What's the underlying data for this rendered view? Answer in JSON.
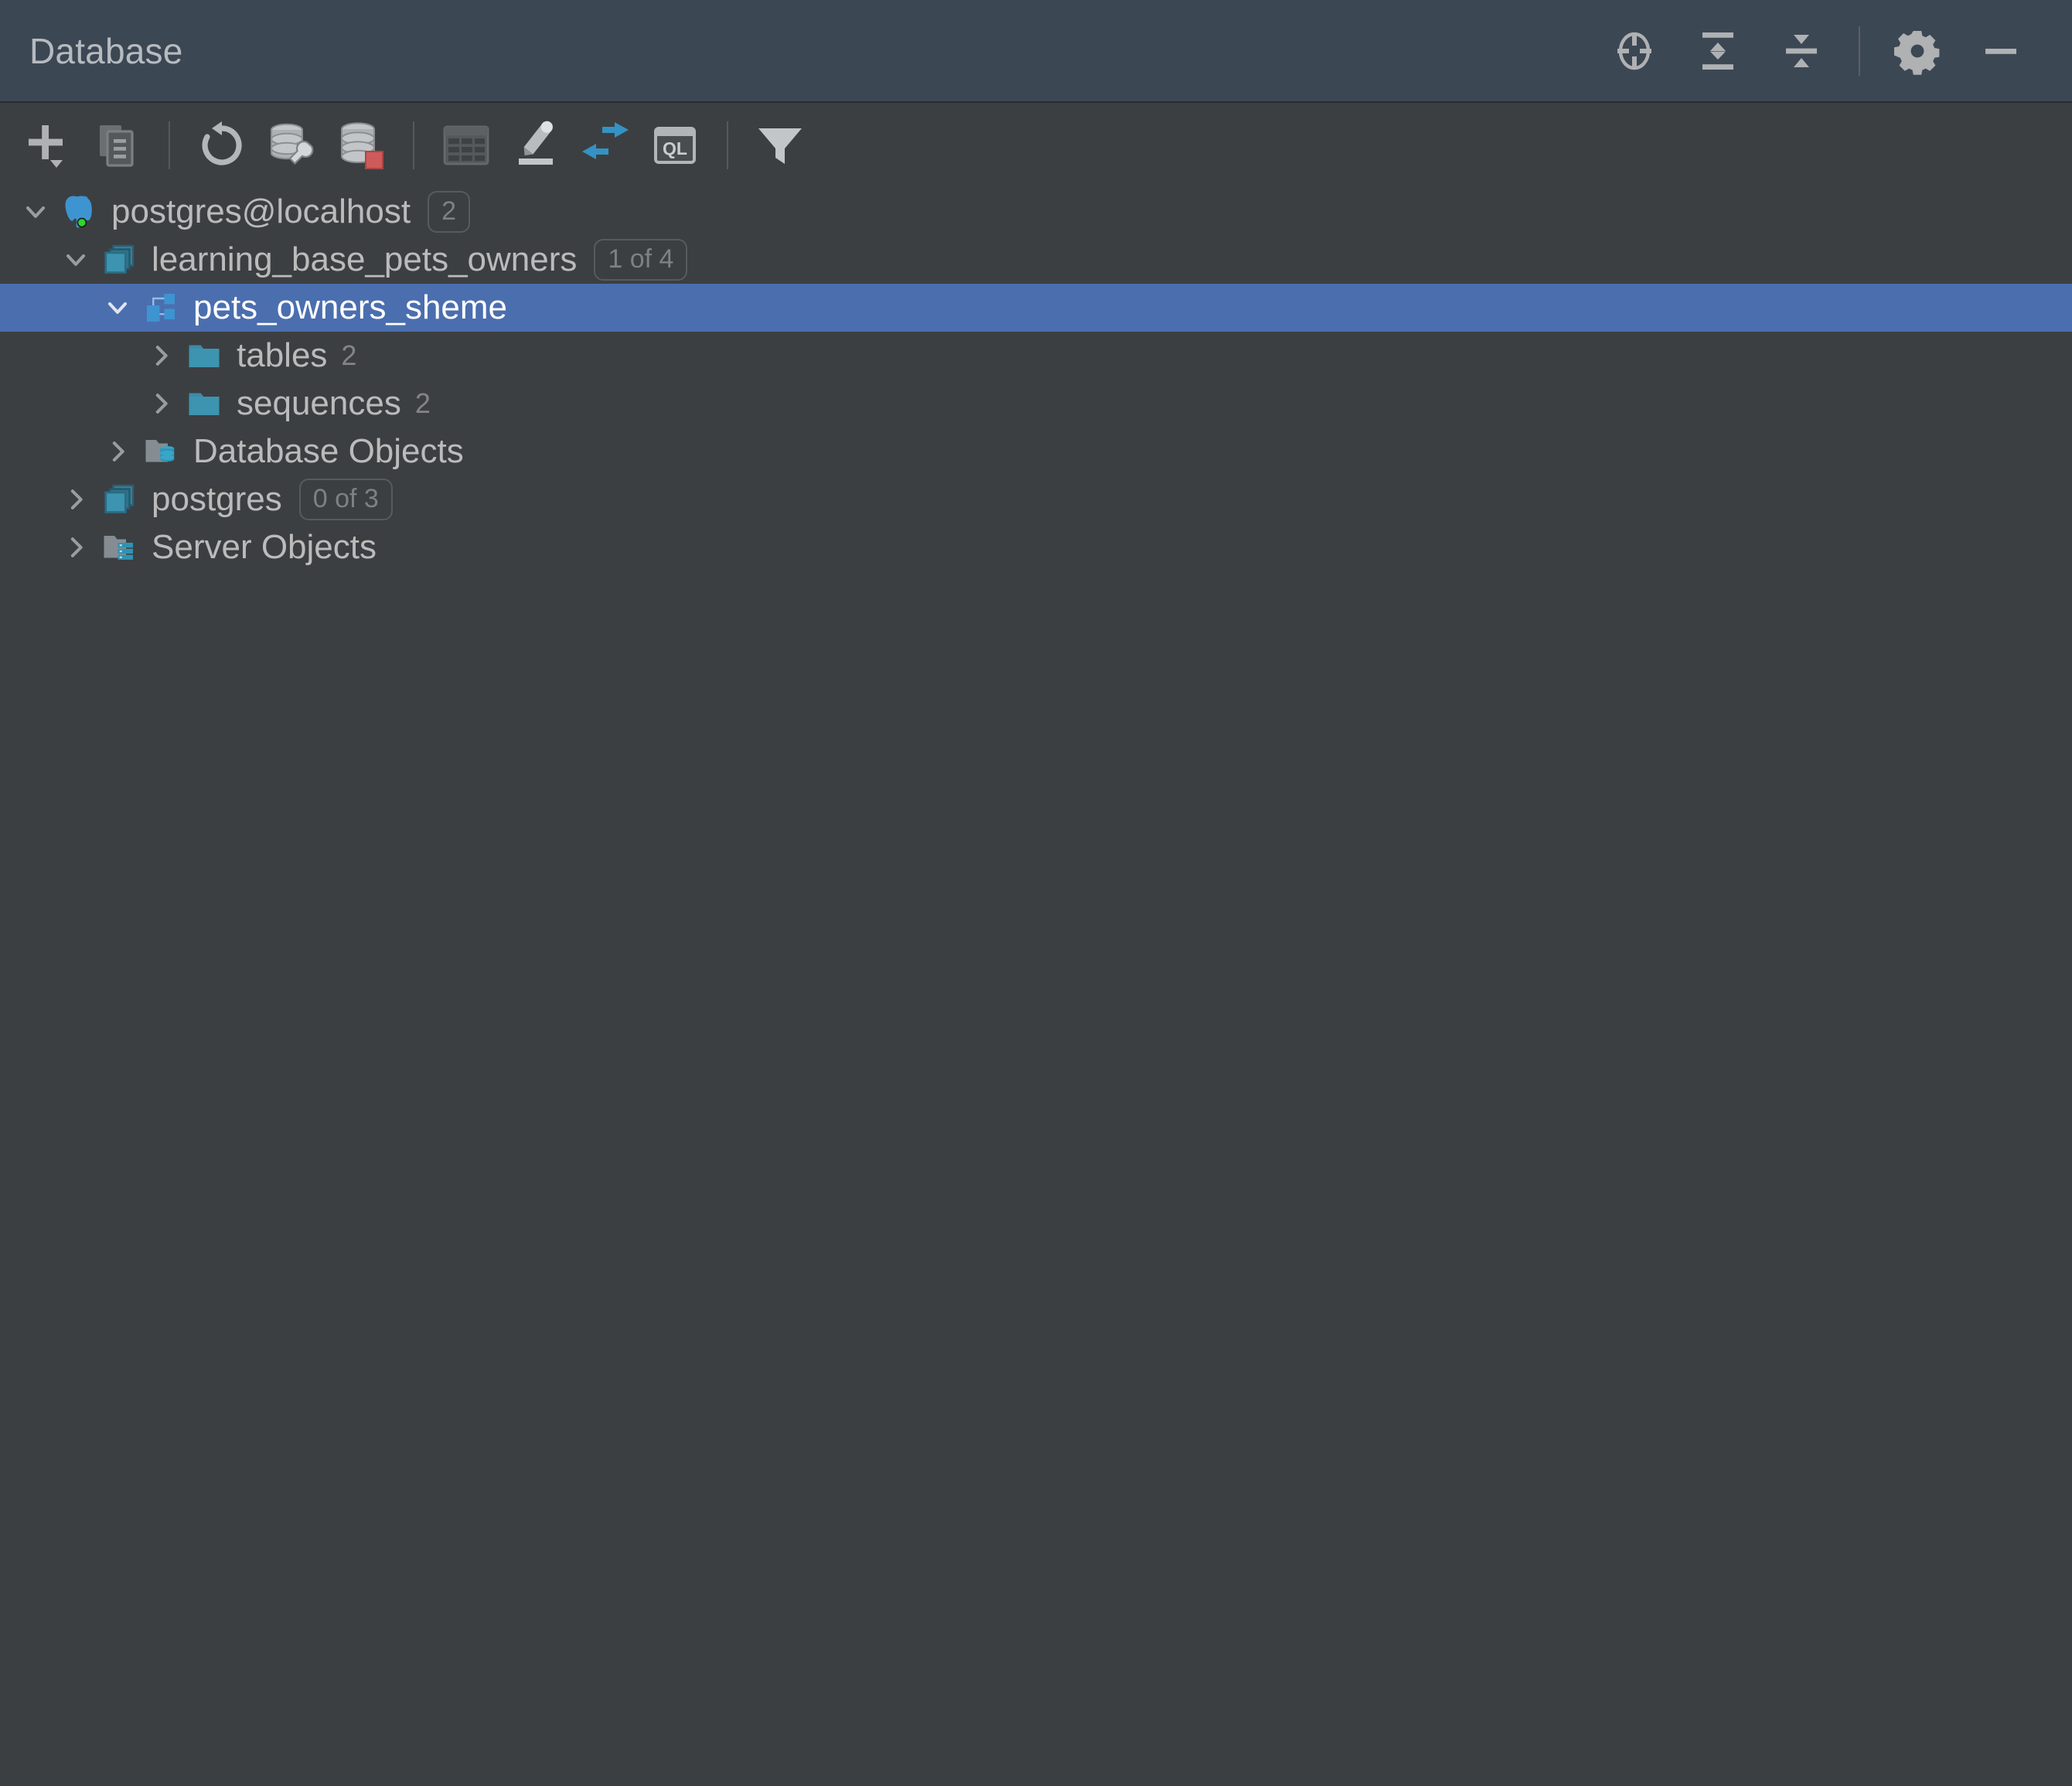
{
  "window": {
    "title": "Database",
    "accent_selection": "#4b6eaf",
    "background": "#3c3f41",
    "header_background": "#3c4754"
  },
  "header": {
    "title": "Database",
    "actions": [
      {
        "name": "scroll-to-source-icon",
        "label": "Scroll to Source"
      },
      {
        "name": "expand-all-icon",
        "label": "Expand All"
      },
      {
        "name": "collapse-all-icon",
        "label": "Collapse All"
      },
      {
        "name": "gear-icon",
        "label": "Options"
      },
      {
        "name": "minimize-icon",
        "label": "Hide"
      }
    ]
  },
  "toolbar": {
    "buttons": [
      {
        "name": "add-new-icon",
        "label": "New"
      },
      {
        "name": "duplicate-icon",
        "label": "Duplicate"
      },
      {
        "name": "separator-1",
        "label": ""
      },
      {
        "name": "refresh-icon",
        "label": "Refresh"
      },
      {
        "name": "database-tools-icon",
        "label": "Database Tools"
      },
      {
        "name": "data-source-properties-icon",
        "label": "Data Source Properties"
      },
      {
        "name": "separator-2",
        "label": ""
      },
      {
        "name": "table-editor-icon",
        "label": "Table Editor"
      },
      {
        "name": "modify-icon",
        "label": "Modify"
      },
      {
        "name": "jump-to-query-console-icon",
        "label": "Jump to Console"
      },
      {
        "name": "query-language-icon",
        "label": "QL"
      },
      {
        "name": "separator-3",
        "label": ""
      },
      {
        "name": "filter-icon",
        "label": "Filter"
      }
    ]
  },
  "tree": {
    "nodes": [
      {
        "id": "connection",
        "label": "postgres@localhost",
        "icon": "postgresql-elephant-icon",
        "indent": 0,
        "twisty": "expanded",
        "badge": "2",
        "count": "",
        "selected": false,
        "status": "connected"
      },
      {
        "id": "database-learning",
        "label": "learning_base_pets_owners",
        "icon": "database-icon",
        "indent": 1,
        "twisty": "expanded",
        "badge": "1 of 4",
        "count": "",
        "selected": false
      },
      {
        "id": "schema-pets-owners",
        "label": "pets_owners_sheme",
        "icon": "schema-icon",
        "indent": 2,
        "twisty": "expanded",
        "badge": "",
        "count": "",
        "selected": true
      },
      {
        "id": "folder-tables",
        "label": "tables",
        "icon": "folder-icon",
        "indent": 3,
        "twisty": "collapsed",
        "badge": "",
        "count": "2",
        "selected": false
      },
      {
        "id": "folder-sequences",
        "label": "sequences",
        "icon": "folder-icon",
        "indent": 3,
        "twisty": "collapsed",
        "badge": "",
        "count": "2",
        "selected": false
      },
      {
        "id": "database-objects",
        "label": "Database Objects",
        "icon": "database-objects-folder-icon",
        "indent": 2,
        "twisty": "collapsed",
        "badge": "",
        "count": "",
        "selected": false
      },
      {
        "id": "database-postgres",
        "label": "postgres",
        "icon": "database-icon",
        "indent": 1,
        "twisty": "collapsed",
        "badge": "0 of 3",
        "count": "",
        "selected": false
      },
      {
        "id": "server-objects",
        "label": "Server Objects",
        "icon": "server-objects-folder-icon",
        "indent": 1,
        "twisty": "collapsed",
        "badge": "",
        "count": "",
        "selected": false
      }
    ]
  }
}
